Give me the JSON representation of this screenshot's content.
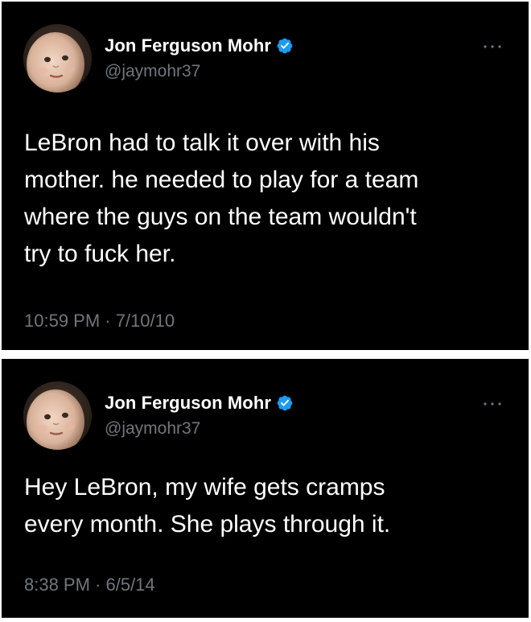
{
  "tweets": [
    {
      "author": {
        "display_name": "Jon Ferguson Mohr",
        "handle": "@jaymohr37",
        "verified": true,
        "avatar_icon": "baby-face-avatar"
      },
      "text": "LeBron had to talk it over with his\nmother. he needed to play for a team\nwhere the guys on the team wouldn't\ntry to fuck her.",
      "timestamp": "10:59 PM · 7/10/10",
      "more_icon": "more-dots-icon"
    },
    {
      "author": {
        "display_name": "Jon Ferguson Mohr",
        "handle": "@jaymohr37",
        "verified": true,
        "avatar_icon": "baby-face-avatar"
      },
      "text": "Hey LeBron, my wife gets cramps\nevery month. She plays through it.",
      "timestamp": "8:38 PM · 6/5/14",
      "more_icon": "more-dots-icon"
    }
  ],
  "colors": {
    "background": "#000000",
    "text": "#ffffff",
    "secondary_text": "#71767b",
    "verified": "#1d9bf0",
    "separator": "#ffffff"
  }
}
